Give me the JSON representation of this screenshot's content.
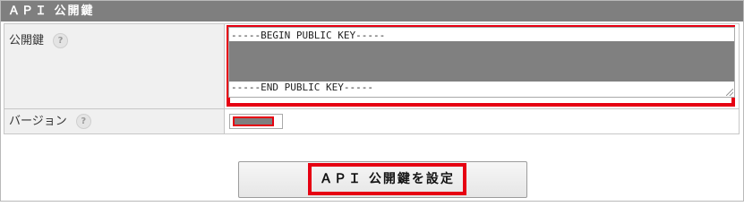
{
  "section": {
    "title": "ＡＰＩ 公開鍵"
  },
  "public_key": {
    "label": "公開鍵",
    "help": "?",
    "begin_line": "-----BEGIN PUBLIC KEY-----",
    "end_line": "-----END PUBLIC KEY-----",
    "masked": true
  },
  "version": {
    "label": "バージョン",
    "help": "?",
    "masked": true
  },
  "submit": {
    "label": "ＡＰＩ 公開鍵を設定"
  },
  "colors": {
    "header_bg": "#7f7f7f",
    "highlight": "#e60012",
    "label_bg": "#f0f0f0",
    "mask": "#808080"
  }
}
